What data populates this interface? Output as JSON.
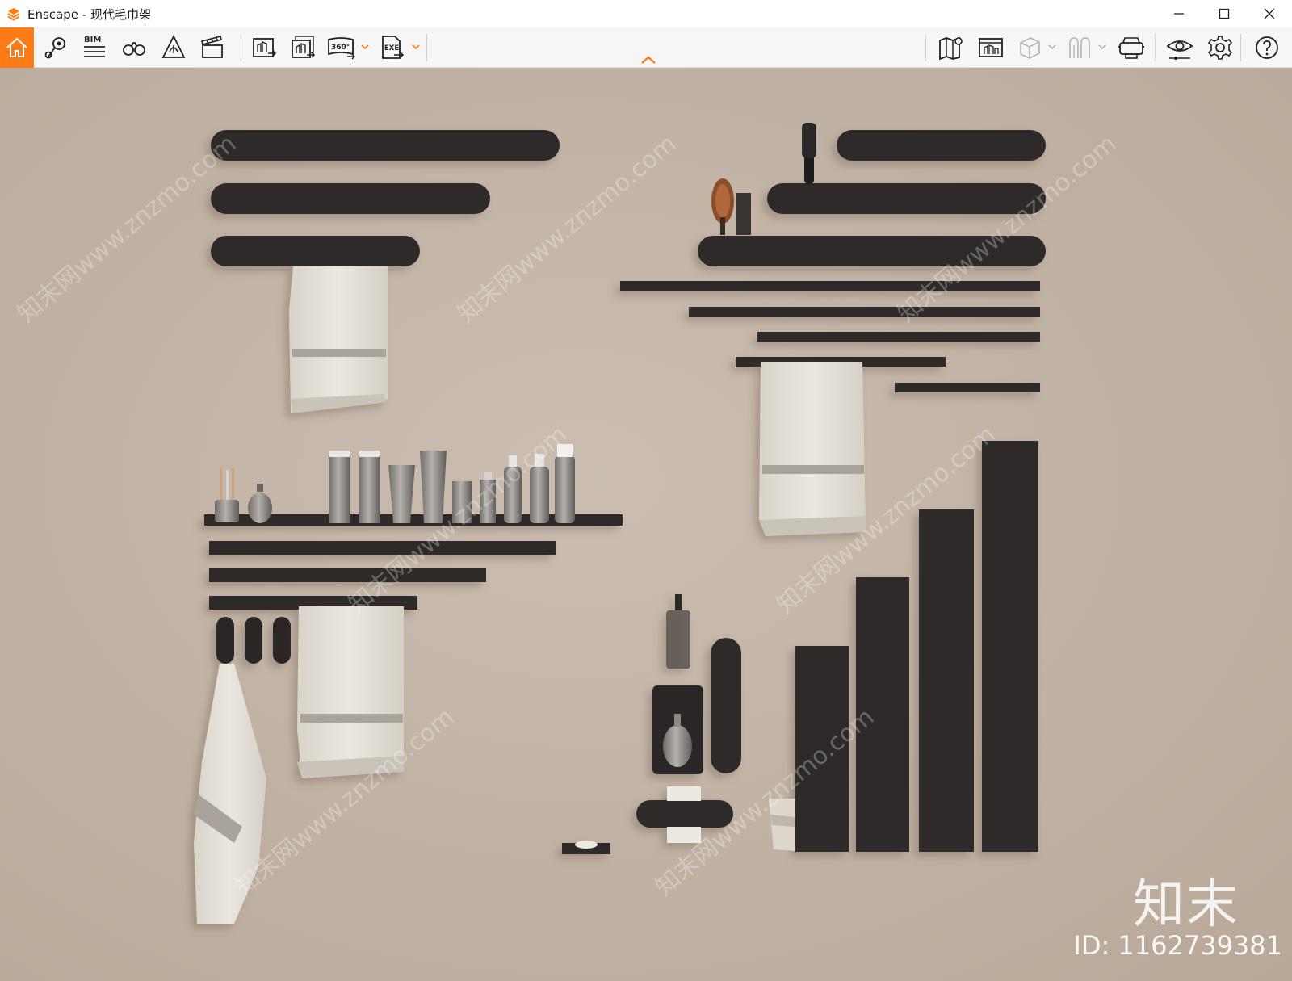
{
  "window": {
    "app_name": "Enscape",
    "separator": " - ",
    "document_title": "现代毛巾架",
    "controls": [
      "minimize",
      "maximize",
      "close"
    ]
  },
  "toolbar": {
    "left_tools": [
      {
        "name": "home-icon",
        "active": true
      },
      {
        "name": "location-pin-icon"
      },
      {
        "name": "bim-icon",
        "label": "BIM"
      },
      {
        "name": "binoculars-icon"
      },
      {
        "name": "asset-library-icon"
      },
      {
        "name": "clapperboard-icon"
      },
      {
        "name": "render-image-icon"
      },
      {
        "name": "batch-render-icon"
      },
      {
        "name": "panorama-360-icon",
        "label": "360°",
        "has_dropdown": true
      },
      {
        "name": "export-exe-icon",
        "label": "EXE",
        "has_dropdown": true
      }
    ],
    "right_tools": [
      {
        "name": "map-icon"
      },
      {
        "name": "render-window-icon"
      },
      {
        "name": "cube-view-icon",
        "has_dropdown": true
      },
      {
        "name": "sun-study-icon",
        "has_dropdown": true
      },
      {
        "name": "vr-headset-icon"
      },
      {
        "name": "visual-settings-eye-icon"
      },
      {
        "name": "settings-gear-icon"
      },
      {
        "name": "help-icon"
      }
    ],
    "accent_color": "#ff7b16"
  },
  "viewport": {
    "watermark_brand": "知末",
    "watermark_id": "ID: 1162739381",
    "watermark_site": "知末网www.znzmo.com",
    "wall_color": "#c3b5a7",
    "fixture_color": "#2e2b29",
    "towel_color": "#e6e1d9"
  }
}
